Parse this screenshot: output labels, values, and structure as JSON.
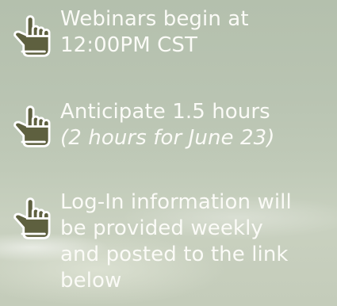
{
  "items": [
    {
      "icon": "pointing-hand-icon",
      "lines": [
        "Webinars begin at",
        "12:00PM CST"
      ]
    },
    {
      "icon": "pointing-hand-icon",
      "lines": [
        "Anticipate 1.5 hours"
      ],
      "note": "(2 hours for June 23)"
    },
    {
      "icon": "pointing-hand-icon",
      "lines": [
        "Log-In information will",
        "be provided weekly",
        "and posted to the link",
        "below"
      ]
    }
  ],
  "colors": {
    "icon_fill": "#5e603f",
    "icon_outline": "#ffffff",
    "text": "#fbfbf7"
  }
}
